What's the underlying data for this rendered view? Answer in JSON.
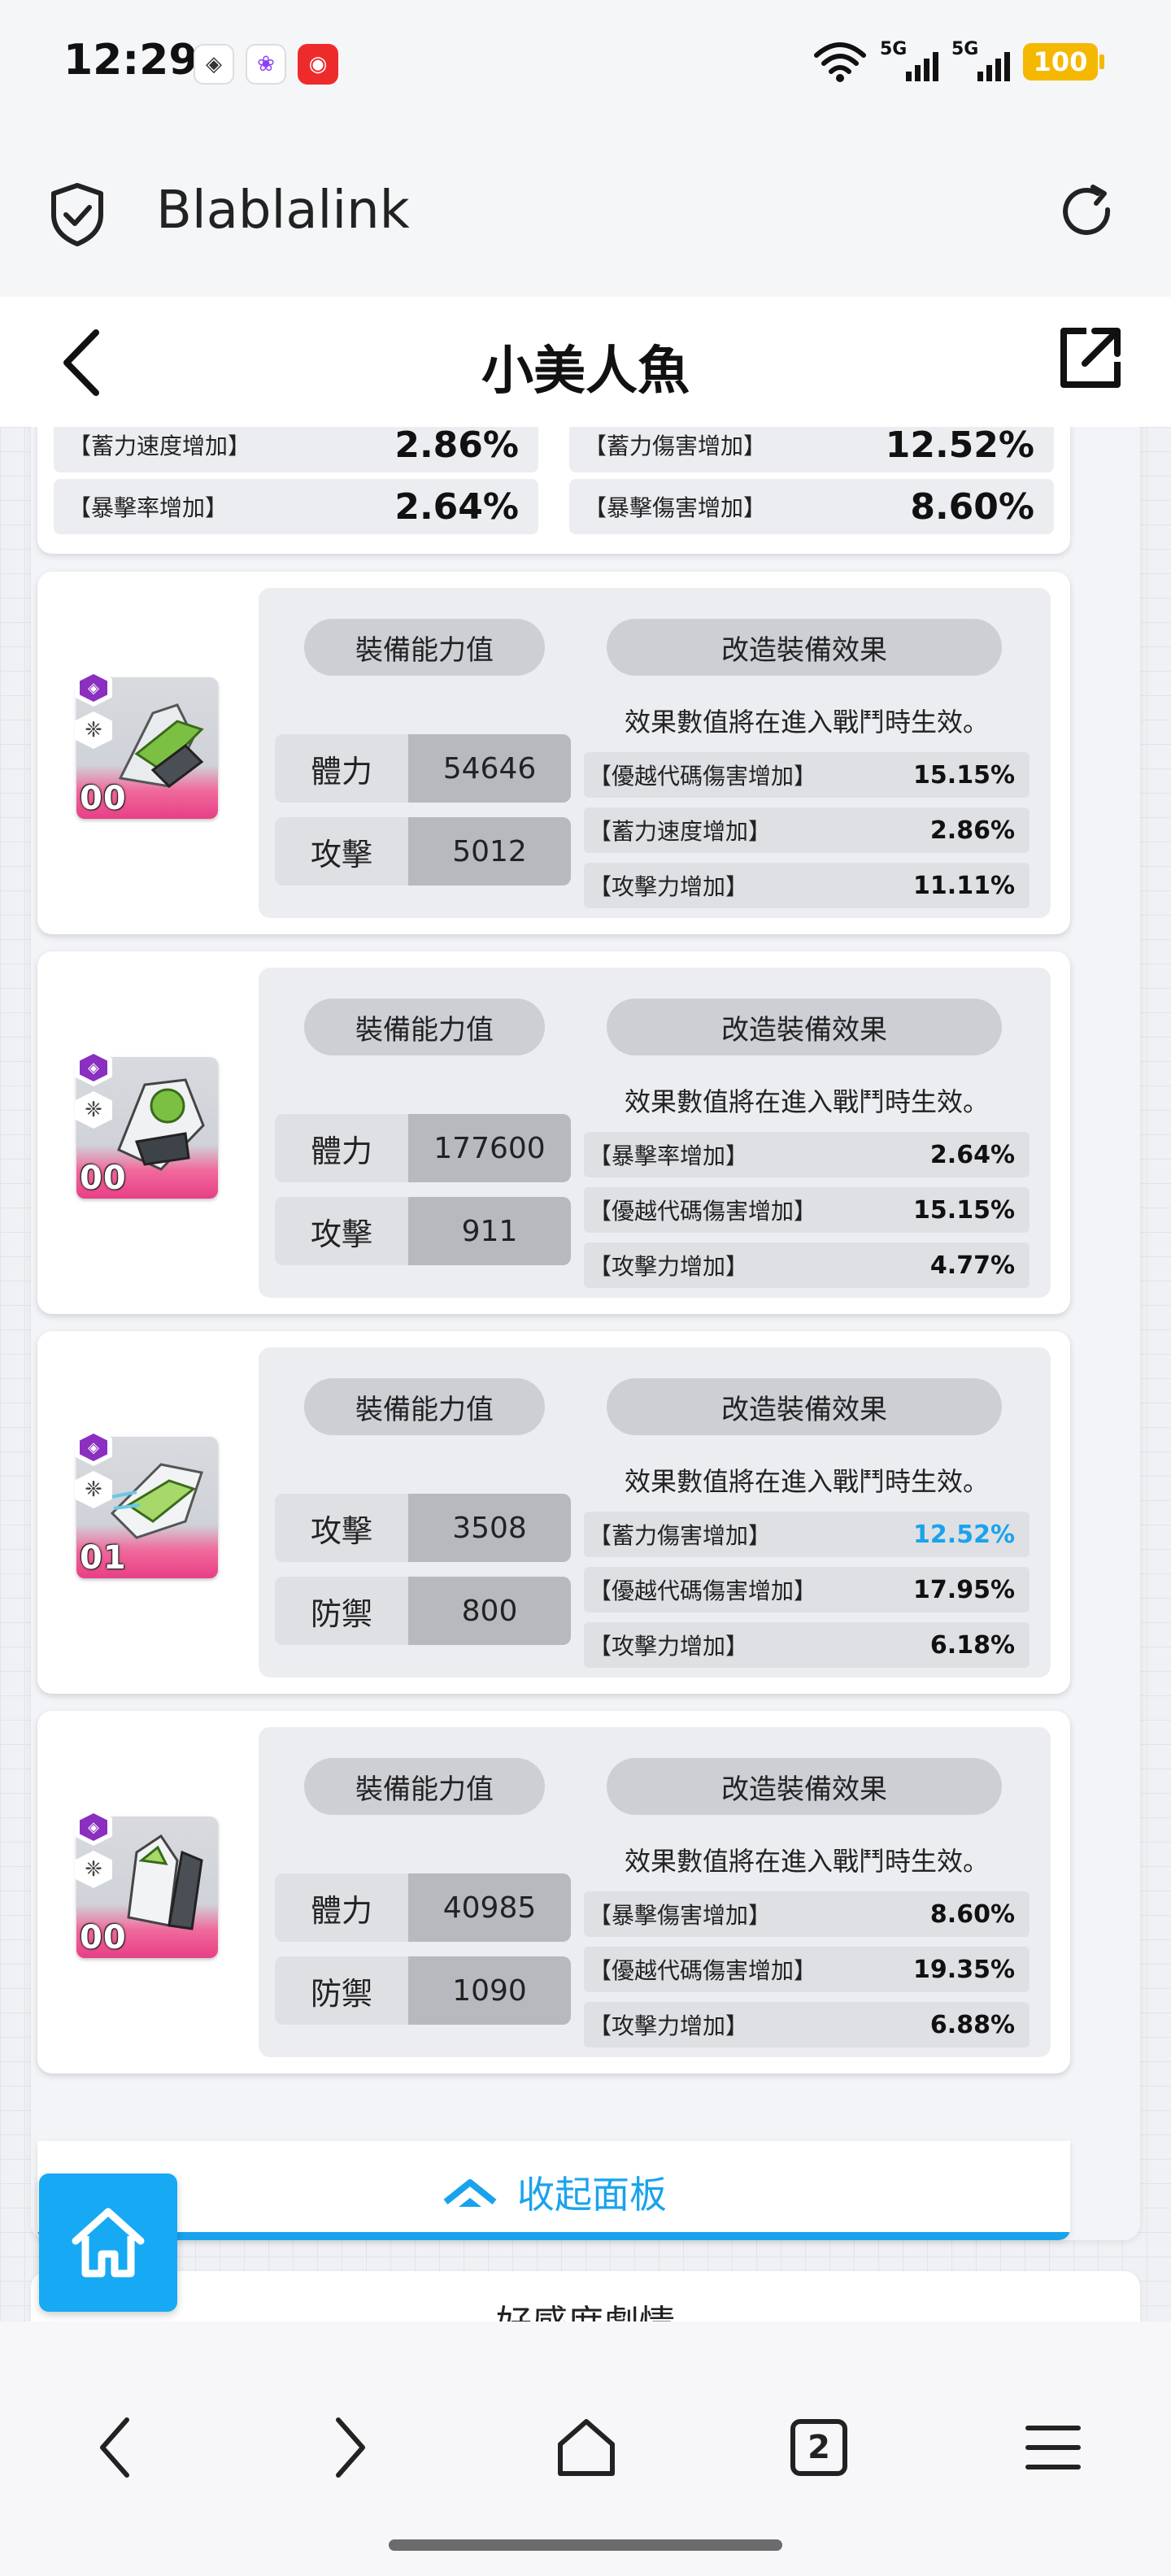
{
  "status_bar": {
    "time": "12:29",
    "network_1": "5G",
    "network_2": "5G",
    "battery": "100"
  },
  "browser": {
    "site_name": "Blablalink"
  },
  "header": {
    "title": "小美人魚"
  },
  "top_stats": [
    {
      "label": "【蓄力速度增加】",
      "value": "2.86%"
    },
    {
      "label": "【蓄力傷害增加】",
      "value": "12.52%"
    },
    {
      "label": "【暴擊率增加】",
      "value": "2.64%"
    },
    {
      "label": "【暴擊傷害增加】",
      "value": "8.60%"
    }
  ],
  "equip_labels": {
    "ability": "裝備能力值",
    "modify": "改造裝備效果",
    "note": "效果數值將在進入戰鬥時生效。"
  },
  "equipment": [
    {
      "level": "00",
      "stats": [
        {
          "name": "體力",
          "value": "54646"
        },
        {
          "name": "攻擊",
          "value": "5012"
        }
      ],
      "effects": [
        {
          "label": "【優越代碼傷害增加】",
          "value": "15.15%"
        },
        {
          "label": "【蓄力速度增加】",
          "value": "2.86%"
        },
        {
          "label": "【攻擊力增加】",
          "value": "11.11%"
        }
      ]
    },
    {
      "level": "00",
      "stats": [
        {
          "name": "體力",
          "value": "177600"
        },
        {
          "name": "攻擊",
          "value": "911"
        }
      ],
      "effects": [
        {
          "label": "【暴擊率增加】",
          "value": "2.64%"
        },
        {
          "label": "【優越代碼傷害增加】",
          "value": "15.15%"
        },
        {
          "label": "【攻擊力增加】",
          "value": "4.77%"
        }
      ]
    },
    {
      "level": "01",
      "stats": [
        {
          "name": "攻擊",
          "value": "3508"
        },
        {
          "name": "防禦",
          "value": "800"
        }
      ],
      "effects": [
        {
          "label": "【蓄力傷害增加】",
          "value": "12.52%",
          "highlight": "#1aa3ec"
        },
        {
          "label": "【優越代碼傷害增加】",
          "value": "17.95%"
        },
        {
          "label": "【攻擊力增加】",
          "value": "6.18%"
        }
      ]
    },
    {
      "level": "00",
      "stats": [
        {
          "name": "體力",
          "value": "40985"
        },
        {
          "name": "防禦",
          "value": "1090"
        }
      ],
      "effects": [
        {
          "label": "【暴擊傷害增加】",
          "value": "8.60%"
        },
        {
          "label": "【優越代碼傷害增加】",
          "value": "19.35%"
        },
        {
          "label": "【攻擊力增加】",
          "value": "6.88%"
        }
      ]
    }
  ],
  "collapse_label": "收起面板",
  "affection_label": "好感度劇情",
  "bottom_nav": {
    "tab_count": "2"
  },
  "colors": {
    "accent": "#1aa3ec",
    "home_fab": "#17a9f4",
    "thumb_pink": "#e83f86"
  },
  "icons": [
    "shield-check-icon",
    "reload-icon",
    "back-arrow-icon",
    "share-icon",
    "chevron-up-icon",
    "home-icon",
    "nav-back-icon",
    "nav-forward-icon",
    "nav-home-icon",
    "nav-menu-icon"
  ]
}
